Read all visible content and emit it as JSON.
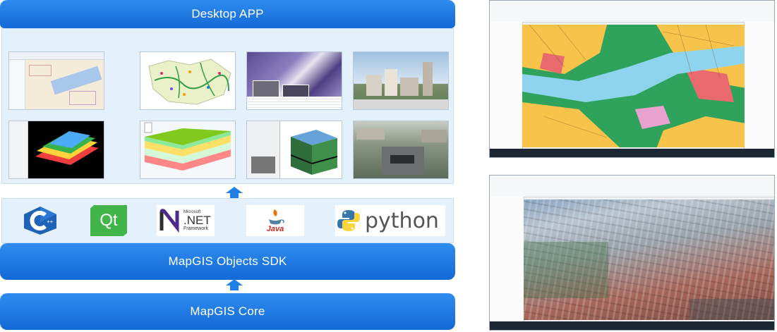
{
  "layers": {
    "app": "Desktop APP",
    "sdk": "MapGIS Objects SDK",
    "core": "MapGIS Core"
  },
  "languages": {
    "qt": "Qt",
    "dotnet_top": "Microsoft",
    "dotnet_main": ".NET",
    "dotnet_bottom": "Framework",
    "java": "Java",
    "python": "python"
  },
  "colors": {
    "bar": "#1a73dc",
    "panel": "#e4f0fc",
    "arrow": "#1f7fe5"
  },
  "thumbnails": [
    {
      "subject": "2d-map-editor"
    },
    {
      "subject": "river-network-map"
    },
    {
      "subject": "remote-sensing-imagery"
    },
    {
      "subject": "3d-city-model"
    },
    {
      "subject": "3d-terrain-layers"
    },
    {
      "subject": "geological-section-model"
    },
    {
      "subject": "3d-geology-cube"
    },
    {
      "subject": "street-scene-3d"
    }
  ]
}
